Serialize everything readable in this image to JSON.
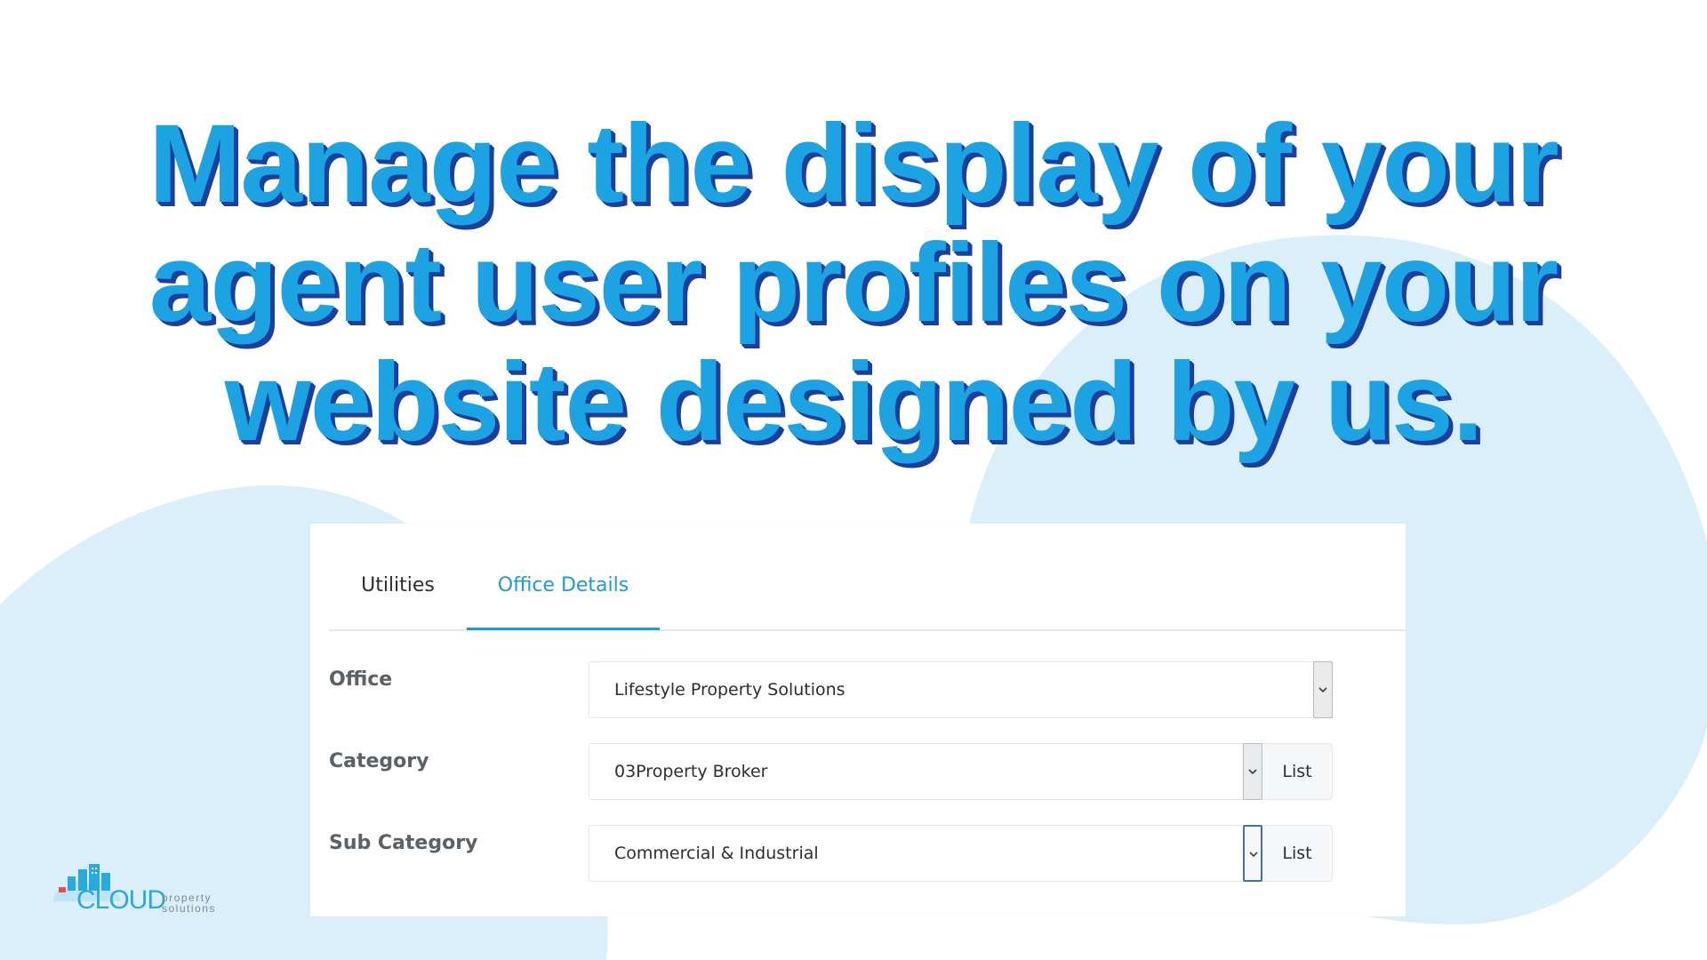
{
  "headline": {
    "lines": [
      "Manage the display of your",
      "agent user profiles on your",
      "website designed by us."
    ]
  },
  "tabs": [
    {
      "label": "Utilities",
      "active": false
    },
    {
      "label": "Office Details",
      "active": true
    }
  ],
  "fields": {
    "office": {
      "label": "Office",
      "value": "Lifestyle Property Solutions"
    },
    "category": {
      "label": "Category",
      "value": "03Property Broker",
      "button": "List"
    },
    "sub_category": {
      "label": "Sub Category",
      "value": "Commercial & Industrial",
      "button": "List"
    }
  },
  "logo": {
    "word": "CLOUD",
    "sub_line1": "property",
    "sub_line2": "solutions"
  },
  "colors": {
    "headline_fill": "#1ba3e4",
    "headline_shadow": "#1c3f9e",
    "active_tab": "#1e9ad6",
    "blob": "#dcf0fa"
  }
}
